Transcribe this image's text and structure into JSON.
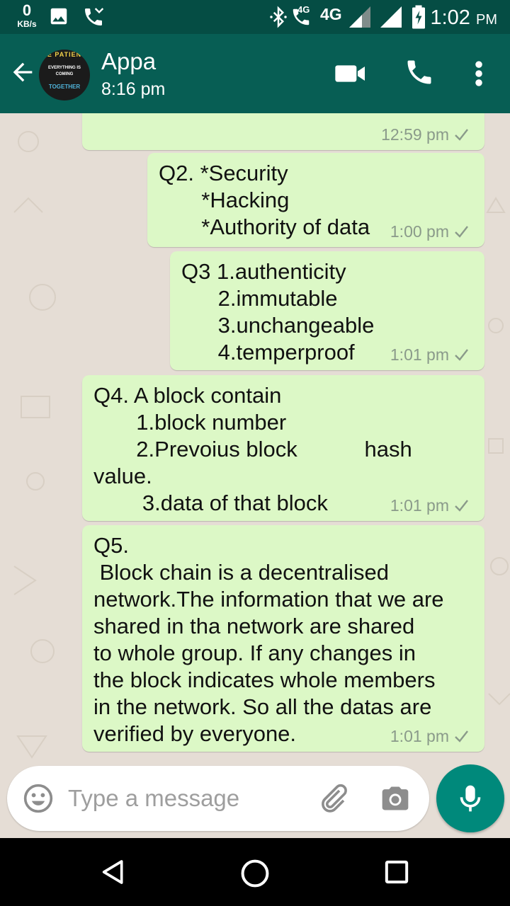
{
  "status_bar": {
    "network_speed": "0",
    "network_speed_unit": "KB/s",
    "volte_label": "4G",
    "network_type": "4G",
    "time": "1:02",
    "ampm": "PM"
  },
  "header": {
    "avatar_text_top": "E PATIEN",
    "avatar_text_mid": "EVERYTHING IS COMING",
    "avatar_text_bottom": "TOGETHER",
    "contact_name": "Appa",
    "subtitle": "8:16 pm"
  },
  "messages": [
    {
      "text": "",
      "time": "12:59 pm"
    },
    {
      "text": "Q2. *Security\n       *Hacking\n       *Authority of data",
      "time": "1:00 pm"
    },
    {
      "text": "Q3 1.authenticity\n      2.immutable\n      3.unchangeable\n      4.temperproof",
      "time": "1:01 pm"
    },
    {
      "text": "Q4. A block contain\n       1.block number\n       2.Prevoius block           hash\nvalue.\n        3.data of that block",
      "time": "1:01 pm"
    },
    {
      "text": "Q5.\n Block chain is a decentralised\nnetwork.The information that we are\nshared in tha network are shared\nto whole group. If any changes in\nthe block indicates whole members\nin the network. So all the datas are\nverified by everyone.",
      "time": "1:01 pm"
    }
  ],
  "input": {
    "placeholder": "Type a message"
  },
  "colors": {
    "header": "#075e54",
    "status_bar": "#054d44",
    "outgoing_bubble": "#dcf8c6",
    "accent": "#00897b"
  }
}
